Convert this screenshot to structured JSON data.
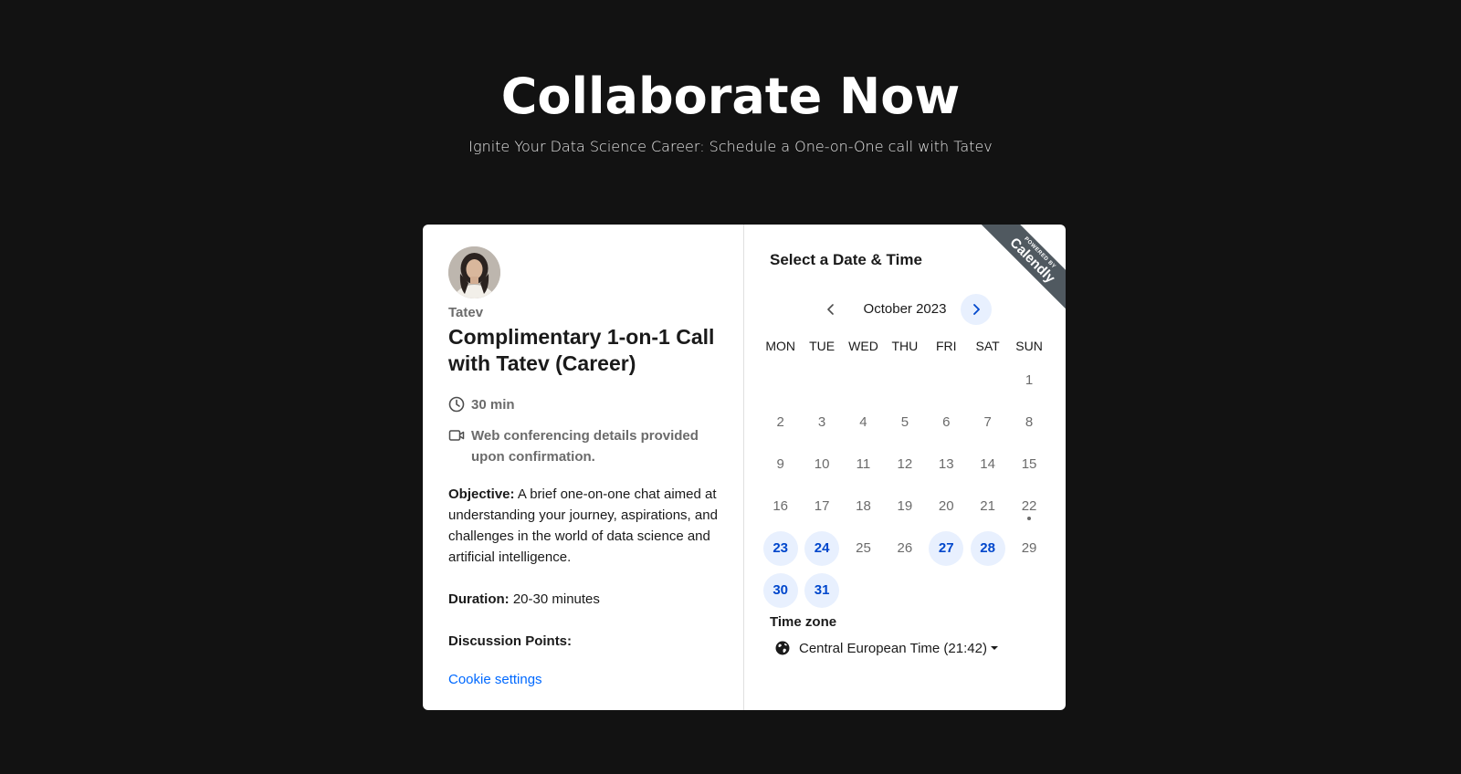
{
  "header": {
    "title": "Collaborate Now",
    "subtitle": "Ignite Your Data Science Career: Schedule a One-on-One call with Tatev"
  },
  "event": {
    "host": "Tatev",
    "title": "Complimentary 1-on-1 Call with Tatev (Career)",
    "duration": "30 min",
    "conferencing": "Web conferencing details provided upon confirmation.",
    "objective_label": "Objective:",
    "objective_text": "A brief one-on-one chat aimed at understanding your journey, aspirations, and challenges in the world of data science and artificial intelligence.",
    "duration_label": "Duration:",
    "duration_text": "20-30 minutes",
    "discussion_label": "Discussion Points:",
    "cookie_settings": "Cookie settings"
  },
  "badge": {
    "small": "POWERED BY",
    "brand": "Calendly"
  },
  "calendar": {
    "section_title": "Select a Date & Time",
    "month": "October 2023",
    "weekdays": [
      "MON",
      "TUE",
      "WED",
      "THU",
      "FRI",
      "SAT",
      "SUN"
    ],
    "weeks": [
      [
        {
          "d": ""
        },
        {
          "d": ""
        },
        {
          "d": ""
        },
        {
          "d": ""
        },
        {
          "d": ""
        },
        {
          "d": ""
        },
        {
          "d": "1"
        }
      ],
      [
        {
          "d": "2"
        },
        {
          "d": "3"
        },
        {
          "d": "4"
        },
        {
          "d": "5"
        },
        {
          "d": "6"
        },
        {
          "d": "7"
        },
        {
          "d": "8"
        }
      ],
      [
        {
          "d": "9"
        },
        {
          "d": "10"
        },
        {
          "d": "11"
        },
        {
          "d": "12"
        },
        {
          "d": "13"
        },
        {
          "d": "14"
        },
        {
          "d": "15"
        }
      ],
      [
        {
          "d": "16"
        },
        {
          "d": "17"
        },
        {
          "d": "18"
        },
        {
          "d": "19"
        },
        {
          "d": "20"
        },
        {
          "d": "21"
        },
        {
          "d": "22",
          "today": true
        }
      ],
      [
        {
          "d": "23",
          "available": true
        },
        {
          "d": "24",
          "available": true
        },
        {
          "d": "25"
        },
        {
          "d": "26"
        },
        {
          "d": "27",
          "available": true
        },
        {
          "d": "28",
          "available": true
        },
        {
          "d": "29"
        }
      ],
      [
        {
          "d": "30",
          "available": true
        },
        {
          "d": "31",
          "available": true
        },
        {
          "d": ""
        },
        {
          "d": ""
        },
        {
          "d": ""
        },
        {
          "d": ""
        },
        {
          "d": ""
        }
      ]
    ]
  },
  "timezone": {
    "label": "Time zone",
    "value": "Central European Time (21:42)"
  },
  "colors": {
    "background": "#121212",
    "accent": "#0069ff",
    "available_bg": "#e8f0fe",
    "available_text": "#0047cc",
    "ribbon": "#505960"
  }
}
